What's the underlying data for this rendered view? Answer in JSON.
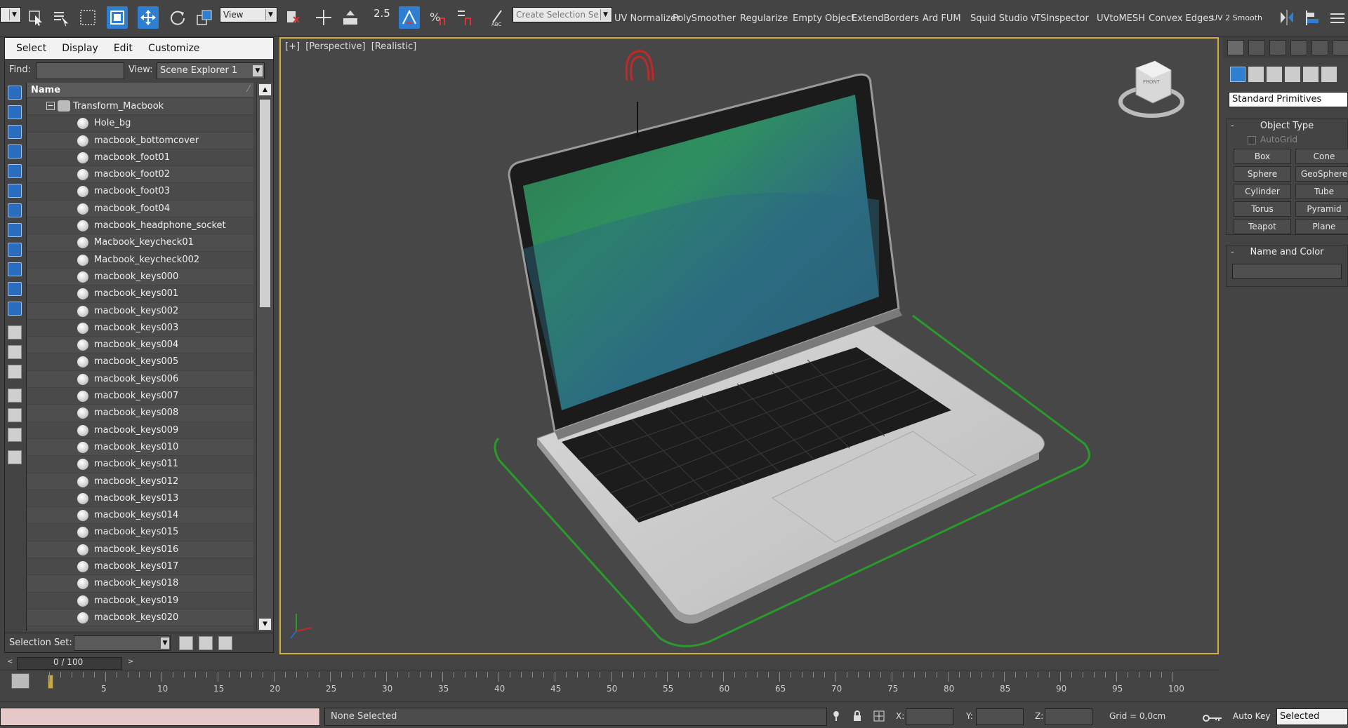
{
  "toolbar": {
    "view_dropdown": "View",
    "snap_value": "2.5",
    "create_selection_set": "Create Selection Se",
    "plugins": [
      "UV Normalizer",
      "PolySmoother",
      "Regularize",
      "Empty Object",
      "ExtendBorders",
      "Ard FUM",
      "Squid Studio v",
      "TSInspector",
      "UVtoMESH",
      "Convex Edges",
      "UV 2 Smooth"
    ]
  },
  "explorer": {
    "menu": [
      "Select",
      "Display",
      "Edit",
      "Customize"
    ],
    "find_label": "Find:",
    "find_value": "",
    "view_label": "View:",
    "view_value": "Scene Explorer 1",
    "column_header": "Name",
    "root": "Transform_Macbook",
    "items": [
      "Hole_bg",
      "macbook_bottomcover",
      "macbook_foot01",
      "macbook_foot02",
      "macbook_foot03",
      "macbook_foot04",
      "macbook_headphone_socket",
      "Macbook_keycheck01",
      "Macbook_keycheck002",
      "macbook_keys000",
      "macbook_keys001",
      "macbook_keys002",
      "macbook_keys003",
      "macbook_keys004",
      "macbook_keys005",
      "macbook_keys006",
      "macbook_keys007",
      "macbook_keys008",
      "macbook_keys009",
      "macbook_keys010",
      "macbook_keys011",
      "macbook_keys012",
      "macbook_keys013",
      "macbook_keys014",
      "macbook_keys015",
      "macbook_keys016",
      "macbook_keys017",
      "macbook_keys018",
      "macbook_keys019",
      "macbook_keys020"
    ],
    "selection_set_label": "Selection Set:"
  },
  "viewport": {
    "label_plus": "[+]",
    "label_view": "[Perspective]",
    "label_shading": "[Realistic]",
    "viewcube_front": "FRONT"
  },
  "timeline": {
    "slider_value": "0 / 100",
    "ticks": [
      5,
      10,
      15,
      20,
      25,
      30,
      35,
      40,
      45,
      50,
      55,
      60,
      65,
      70,
      75,
      80,
      85,
      90,
      95,
      100
    ]
  },
  "status": {
    "text": "None Selected",
    "x_label": "X:",
    "y_label": "Y:",
    "z_label": "Z:",
    "grid": "Grid = 0,0cm",
    "auto_key": "Auto Key",
    "selected": "Selected"
  },
  "command_panel": {
    "dropdown": "Standard Primitives",
    "object_type_title": "Object Type",
    "autogrid": "AutoGrid",
    "buttons": [
      "Box",
      "Cone",
      "Sphere",
      "GeoSphere",
      "Cylinder",
      "Tube",
      "Torus",
      "Pyramid",
      "Teapot",
      "Plane"
    ],
    "name_color_title": "Name and Color"
  },
  "colors": {
    "active_blue": "#2e7fd1",
    "viewport_border": "#d4b03a",
    "selection_outline": "#2a9a2a",
    "gizmo_red": "#c0282a"
  }
}
